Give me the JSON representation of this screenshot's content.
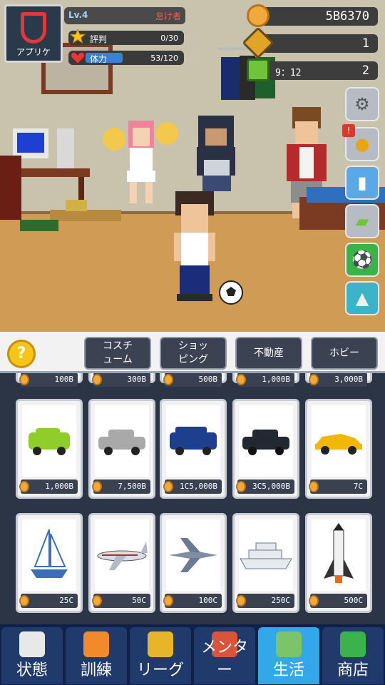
{
  "hud": {
    "app_label": "アプリケ",
    "level": "Lv.4",
    "rank": "怠け者",
    "reputation_label": "評判",
    "reputation_value": "0/30",
    "stamina_label": "体力",
    "stamina_value": "53/120",
    "stamina_fraction": 0.44
  },
  "resources": {
    "coins": "5B6370",
    "gems": "1",
    "tickets": "2",
    "ticket_timer": "9：12"
  },
  "side_buttons": [
    {
      "icon": "gear-icon"
    },
    {
      "icon": "medal-icon"
    },
    {
      "icon": "ranking-icon"
    },
    {
      "icon": "ticket-icon"
    },
    {
      "icon": "soccer-ball-icon"
    },
    {
      "icon": "energy-drink-icon"
    }
  ],
  "tabs": [
    {
      "label": "コスチ\nューム"
    },
    {
      "label": "ショッ\nピング"
    },
    {
      "label": "不動産"
    },
    {
      "label": "ホビー"
    }
  ],
  "help_label": "?",
  "top_prices": [
    "100B",
    "300B",
    "500B",
    "1,000B",
    "3,000B"
  ],
  "items": [
    {
      "name": "green compact car",
      "price": "1,000B",
      "color": "#8fce2a"
    },
    {
      "name": "silver sedan",
      "price": "7,500B",
      "color": "#a9a9a9"
    },
    {
      "name": "blue suv",
      "price": "1C5,000B",
      "color": "#1e3f8f"
    },
    {
      "name": "black luxury sedan",
      "price": "3C5,000B",
      "color": "#222831"
    },
    {
      "name": "yellow sports car",
      "price": "7C",
      "color": "#f2b705"
    },
    {
      "name": "sailboat",
      "price": "25C",
      "color": "#3d6fb8"
    },
    {
      "name": "private jet",
      "price": "50C",
      "color": "#d8dde6"
    },
    {
      "name": "fighter jet",
      "price": "100C",
      "color": "#7f8ea3"
    },
    {
      "name": "cruise ship",
      "price": "250C",
      "color": "#e6e9ee"
    },
    {
      "name": "space shuttle",
      "price": "500C",
      "color": "#f0f0f0"
    }
  ],
  "nav": [
    {
      "label": "状態",
      "icon": "notepad-icon"
    },
    {
      "label": "訓練",
      "icon": "cones-icon"
    },
    {
      "label": "リーグ",
      "icon": "trophy-icon"
    },
    {
      "label": "メンター",
      "icon": "mentor-icon"
    },
    {
      "label": "生活",
      "icon": "city-icon",
      "active": true
    },
    {
      "label": "商店",
      "icon": "cart-icon"
    }
  ]
}
